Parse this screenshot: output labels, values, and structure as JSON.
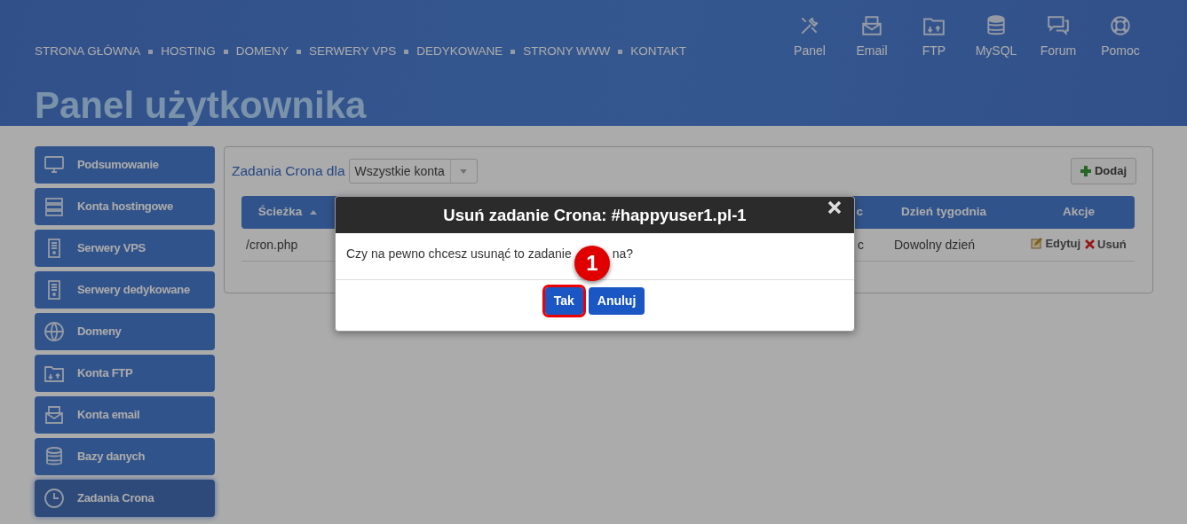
{
  "header": {
    "nav": [
      "STRONA GŁÓWNA",
      "HOSTING",
      "DOMENY",
      "SERWERY VPS",
      "DEDYKOWANE",
      "STRONY WWW",
      "KONTAKT"
    ],
    "shortcuts": [
      {
        "label": "Panel"
      },
      {
        "label": "Email"
      },
      {
        "label": "FTP"
      },
      {
        "label": "MySQL"
      },
      {
        "label": "Forum"
      },
      {
        "label": "Pomoc"
      }
    ],
    "title": "Panel użytkownika"
  },
  "sidebar": {
    "items": [
      {
        "label": "Podsumowanie",
        "selected": false
      },
      {
        "label": "Konta hostingowe",
        "selected": false
      },
      {
        "label": "Serwery VPS",
        "selected": false
      },
      {
        "label": "Serwery dedykowane",
        "selected": false
      },
      {
        "label": "Domeny",
        "selected": false
      },
      {
        "label": "Konta FTP",
        "selected": false
      },
      {
        "label": "Konta email",
        "selected": false
      },
      {
        "label": "Bazy danych",
        "selected": false
      },
      {
        "label": "Zadania Crona",
        "selected": true
      }
    ]
  },
  "panel": {
    "title": "Zadania Crona dla",
    "account_select": {
      "value": "Wszystkie konta"
    },
    "add_button": "Dodaj",
    "table": {
      "columns": [
        {
          "label": "Ścieżka",
          "sorted": true
        },
        {
          "label": "c",
          "sorted": false
        },
        {
          "label": "Dzień tygodnia",
          "sorted": false
        },
        {
          "label": "Akcje",
          "sorted": false
        }
      ],
      "rows": [
        {
          "cells": [
            "/cron.php",
            "c",
            "Dowolny dzień"
          ],
          "actions": [
            {
              "kind": "edit",
              "label": "Edytuj"
            },
            {
              "kind": "delete",
              "label": "Usuń"
            }
          ]
        }
      ]
    }
  },
  "modal": {
    "title": "Usuń zadanie Crona: #happyuser1.pl-1",
    "message": [
      "Czy na pewno chcesz usunąć to zadanie",
      "na?"
    ],
    "buttons": [
      {
        "label": "Tak",
        "highlighted": true
      },
      {
        "label": "Anuluj",
        "highlighted": false
      }
    ],
    "step_badge": "1"
  }
}
